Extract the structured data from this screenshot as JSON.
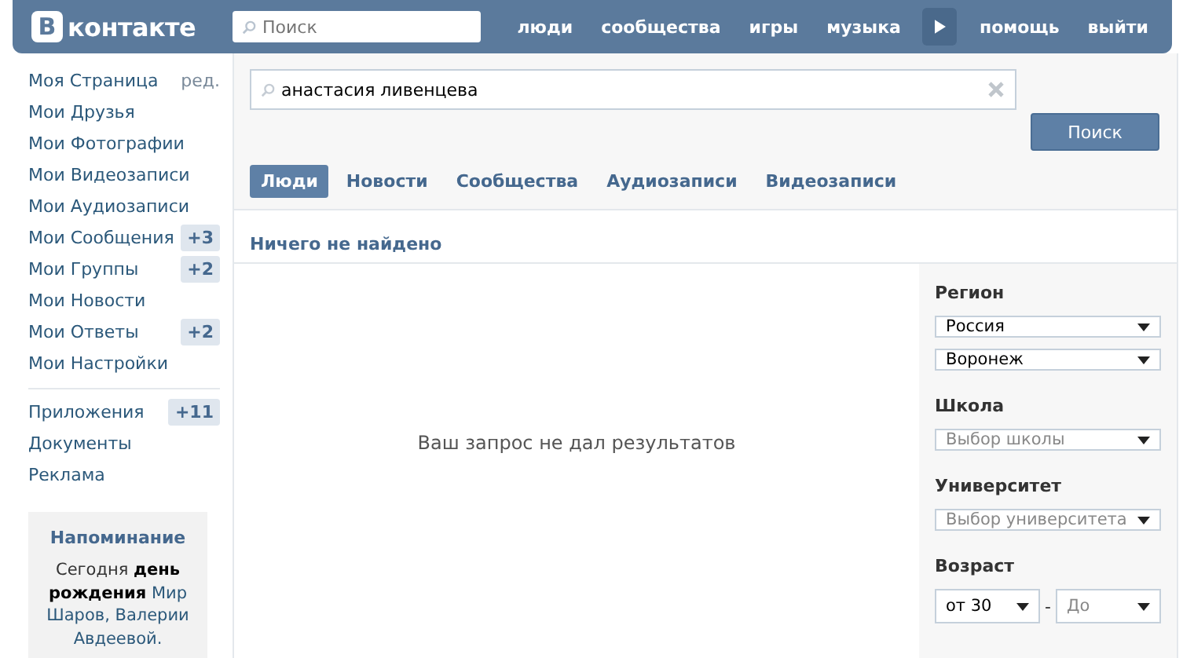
{
  "header": {
    "logo_letter": "В",
    "logo_text": "контакте",
    "search": {
      "placeholder": "Поиск"
    },
    "nav": [
      {
        "label": "люди",
        "kind": "link"
      },
      {
        "label": "сообщества",
        "kind": "link"
      },
      {
        "label": "игры",
        "kind": "link"
      },
      {
        "label": "музыка",
        "kind": "link"
      },
      {
        "kind": "play"
      },
      {
        "label": "помощь",
        "kind": "link"
      },
      {
        "label": "выйти",
        "kind": "link"
      }
    ]
  },
  "sidebar": {
    "edit": "ред.",
    "groups": [
      [
        {
          "label": "Моя Страница"
        },
        {
          "label": "Мои Друзья"
        },
        {
          "label": "Мои Фотографии"
        },
        {
          "label": "Мои Видеозаписи"
        },
        {
          "label": "Мои Аудиозаписи"
        },
        {
          "label": "Мои Сообщения",
          "badge": "+3"
        },
        {
          "label": "Мои Группы",
          "badge": "+2"
        },
        {
          "label": "Мои Новости"
        },
        {
          "label": "Мои Ответы",
          "badge": "+2"
        },
        {
          "label": "Мои Настройки"
        }
      ],
      [
        {
          "label": "Приложения",
          "badge": "+11"
        },
        {
          "label": "Документы"
        },
        {
          "label": "Реклама"
        }
      ]
    ],
    "reminder": {
      "title": "Напоминание",
      "parts": [
        {
          "text": "Сегодня ",
          "kind": "plain"
        },
        {
          "text": "день рождения",
          "kind": "strong"
        },
        {
          "text": " Мир Шаров, Валерии Авдеевой.",
          "kind": "link"
        }
      ]
    }
  },
  "search": {
    "value": "анастасия ливенцева",
    "button": "Поиск"
  },
  "tabs": [
    {
      "label": "Люди",
      "selected": true
    },
    {
      "label": "Новости",
      "selected": false
    },
    {
      "label": "Сообщества",
      "selected": false
    },
    {
      "label": "Аудиозаписи",
      "selected": false
    },
    {
      "label": "Видеозаписи",
      "selected": false
    }
  ],
  "results": {
    "heading": "Ничего не найдено",
    "empty": "Ваш запрос не дал результатов"
  },
  "filters": [
    {
      "title": "Регион",
      "kind": "stack",
      "selects": [
        {
          "value": "Россия"
        },
        {
          "value": "Воронеж"
        }
      ]
    },
    {
      "title": "Школа",
      "kind": "stack",
      "selects": [
        {
          "placeholder": "Выбор школы"
        }
      ]
    },
    {
      "title": "Университет",
      "kind": "stack",
      "selects": [
        {
          "placeholder": "Выбор университета"
        }
      ]
    },
    {
      "title": "Возраст",
      "kind": "range",
      "separator": "-",
      "selects": [
        {
          "value": "от 30"
        },
        {
          "placeholder": "До"
        }
      ]
    }
  ]
}
